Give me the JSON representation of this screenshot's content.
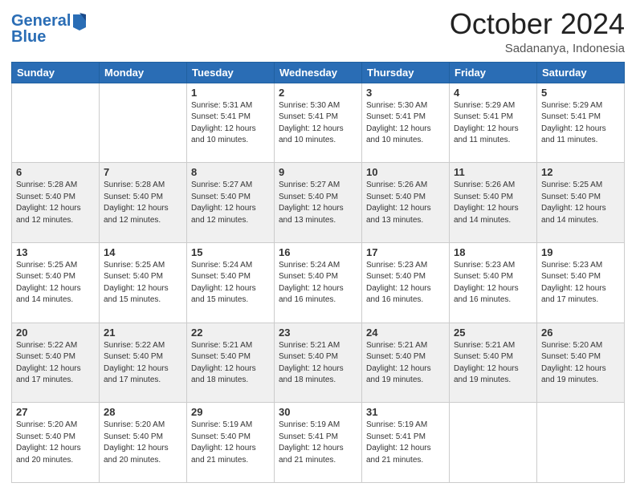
{
  "header": {
    "logo_line1": "General",
    "logo_line2": "Blue",
    "month": "October 2024",
    "location": "Sadananya, Indonesia"
  },
  "weekdays": [
    "Sunday",
    "Monday",
    "Tuesday",
    "Wednesday",
    "Thursday",
    "Friday",
    "Saturday"
  ],
  "weeks": [
    [
      {
        "day": "",
        "info": ""
      },
      {
        "day": "",
        "info": ""
      },
      {
        "day": "1",
        "info": "Sunrise: 5:31 AM\nSunset: 5:41 PM\nDaylight: 12 hours\nand 10 minutes."
      },
      {
        "day": "2",
        "info": "Sunrise: 5:30 AM\nSunset: 5:41 PM\nDaylight: 12 hours\nand 10 minutes."
      },
      {
        "day": "3",
        "info": "Sunrise: 5:30 AM\nSunset: 5:41 PM\nDaylight: 12 hours\nand 10 minutes."
      },
      {
        "day": "4",
        "info": "Sunrise: 5:29 AM\nSunset: 5:41 PM\nDaylight: 12 hours\nand 11 minutes."
      },
      {
        "day": "5",
        "info": "Sunrise: 5:29 AM\nSunset: 5:41 PM\nDaylight: 12 hours\nand 11 minutes."
      }
    ],
    [
      {
        "day": "6",
        "info": "Sunrise: 5:28 AM\nSunset: 5:40 PM\nDaylight: 12 hours\nand 12 minutes."
      },
      {
        "day": "7",
        "info": "Sunrise: 5:28 AM\nSunset: 5:40 PM\nDaylight: 12 hours\nand 12 minutes."
      },
      {
        "day": "8",
        "info": "Sunrise: 5:27 AM\nSunset: 5:40 PM\nDaylight: 12 hours\nand 12 minutes."
      },
      {
        "day": "9",
        "info": "Sunrise: 5:27 AM\nSunset: 5:40 PM\nDaylight: 12 hours\nand 13 minutes."
      },
      {
        "day": "10",
        "info": "Sunrise: 5:26 AM\nSunset: 5:40 PM\nDaylight: 12 hours\nand 13 minutes."
      },
      {
        "day": "11",
        "info": "Sunrise: 5:26 AM\nSunset: 5:40 PM\nDaylight: 12 hours\nand 14 minutes."
      },
      {
        "day": "12",
        "info": "Sunrise: 5:25 AM\nSunset: 5:40 PM\nDaylight: 12 hours\nand 14 minutes."
      }
    ],
    [
      {
        "day": "13",
        "info": "Sunrise: 5:25 AM\nSunset: 5:40 PM\nDaylight: 12 hours\nand 14 minutes."
      },
      {
        "day": "14",
        "info": "Sunrise: 5:25 AM\nSunset: 5:40 PM\nDaylight: 12 hours\nand 15 minutes."
      },
      {
        "day": "15",
        "info": "Sunrise: 5:24 AM\nSunset: 5:40 PM\nDaylight: 12 hours\nand 15 minutes."
      },
      {
        "day": "16",
        "info": "Sunrise: 5:24 AM\nSunset: 5:40 PM\nDaylight: 12 hours\nand 16 minutes."
      },
      {
        "day": "17",
        "info": "Sunrise: 5:23 AM\nSunset: 5:40 PM\nDaylight: 12 hours\nand 16 minutes."
      },
      {
        "day": "18",
        "info": "Sunrise: 5:23 AM\nSunset: 5:40 PM\nDaylight: 12 hours\nand 16 minutes."
      },
      {
        "day": "19",
        "info": "Sunrise: 5:23 AM\nSunset: 5:40 PM\nDaylight: 12 hours\nand 17 minutes."
      }
    ],
    [
      {
        "day": "20",
        "info": "Sunrise: 5:22 AM\nSunset: 5:40 PM\nDaylight: 12 hours\nand 17 minutes."
      },
      {
        "day": "21",
        "info": "Sunrise: 5:22 AM\nSunset: 5:40 PM\nDaylight: 12 hours\nand 17 minutes."
      },
      {
        "day": "22",
        "info": "Sunrise: 5:21 AM\nSunset: 5:40 PM\nDaylight: 12 hours\nand 18 minutes."
      },
      {
        "day": "23",
        "info": "Sunrise: 5:21 AM\nSunset: 5:40 PM\nDaylight: 12 hours\nand 18 minutes."
      },
      {
        "day": "24",
        "info": "Sunrise: 5:21 AM\nSunset: 5:40 PM\nDaylight: 12 hours\nand 19 minutes."
      },
      {
        "day": "25",
        "info": "Sunrise: 5:21 AM\nSunset: 5:40 PM\nDaylight: 12 hours\nand 19 minutes."
      },
      {
        "day": "26",
        "info": "Sunrise: 5:20 AM\nSunset: 5:40 PM\nDaylight: 12 hours\nand 19 minutes."
      }
    ],
    [
      {
        "day": "27",
        "info": "Sunrise: 5:20 AM\nSunset: 5:40 PM\nDaylight: 12 hours\nand 20 minutes."
      },
      {
        "day": "28",
        "info": "Sunrise: 5:20 AM\nSunset: 5:40 PM\nDaylight: 12 hours\nand 20 minutes."
      },
      {
        "day": "29",
        "info": "Sunrise: 5:19 AM\nSunset: 5:40 PM\nDaylight: 12 hours\nand 21 minutes."
      },
      {
        "day": "30",
        "info": "Sunrise: 5:19 AM\nSunset: 5:41 PM\nDaylight: 12 hours\nand 21 minutes."
      },
      {
        "day": "31",
        "info": "Sunrise: 5:19 AM\nSunset: 5:41 PM\nDaylight: 12 hours\nand 21 minutes."
      },
      {
        "day": "",
        "info": ""
      },
      {
        "day": "",
        "info": ""
      }
    ]
  ]
}
